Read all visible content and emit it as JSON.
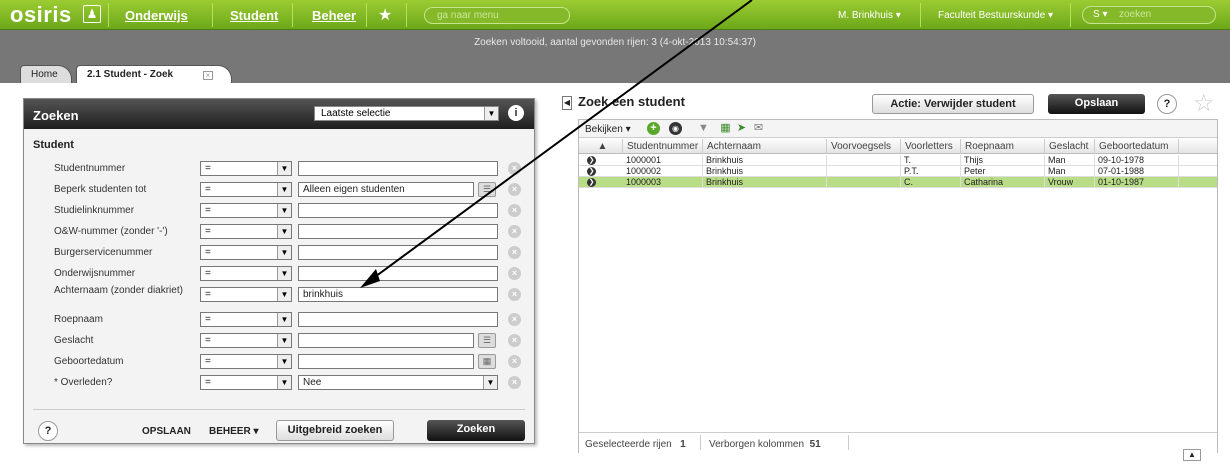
{
  "topbar": {
    "logo": "osiris",
    "logo_icon": "person-icon",
    "nav": [
      "Onderwijs",
      "Student",
      "Beheer"
    ],
    "favorites_icon": "star-icon",
    "menu_search_placeholder": "ga naar menu",
    "user": "M. Brinkhuis ▾",
    "faculty": "Faculteit Bestuurskunde ▾",
    "search_scope": "S ▾",
    "search_placeholder": "zoeken"
  },
  "status": "Zoeken voltooid, aantal gevonden rijen: 3 (4-okt-2013 10:54:37)",
  "tabs": [
    {
      "label": "Home"
    },
    {
      "label": "2.1 Student - Zoek"
    }
  ],
  "search_panel": {
    "title": "Zoeken",
    "saved_selection": "Laatste selectie",
    "section": "Student",
    "fields": [
      {
        "label": "Studentnummer",
        "op": "=",
        "value": ""
      },
      {
        "label": "Beperk studenten tot",
        "op": "=",
        "value": "Alleen eigen studenten"
      },
      {
        "label": "Studielinknummer",
        "op": "=",
        "value": ""
      },
      {
        "label": "O&W-nummer (zonder '-')",
        "op": "=",
        "value": ""
      },
      {
        "label": "Burgerservicenummer",
        "op": "=",
        "value": ""
      },
      {
        "label": "Onderwijsnummer",
        "op": "=",
        "value": ""
      },
      {
        "label": "Achternaam (zonder diakriet)",
        "op": "=",
        "value": "brinkhuis"
      },
      {
        "label": "Roepnaam",
        "op": "=",
        "value": ""
      },
      {
        "label": "Geslacht",
        "op": "=",
        "value": ""
      },
      {
        "label": "Geboortedatum",
        "op": "=",
        "value": ""
      },
      {
        "label": "* Overleden?",
        "op": "=",
        "value": "Nee"
      }
    ],
    "footer": {
      "help": "?",
      "save": "OPSLAAN",
      "manage": "BEHEER ▾",
      "advanced": "Uitgebreid zoeken",
      "search": "Zoeken"
    }
  },
  "results": {
    "title": "Zoek een student",
    "action_button": "Actie: Verwijder student",
    "save_button": "Opslaan",
    "help": "?",
    "toolbar": {
      "view": "Bekijken ▾"
    },
    "columns": [
      "",
      "Studentnummer",
      "Achternaam",
      "Voorvoegsels",
      "Voorletters",
      "Roepnaam",
      "Geslacht",
      "Geboortedatum"
    ],
    "rows": [
      [
        "1000001",
        "Brinkhuis",
        "",
        "T.",
        "Thijs",
        "Man",
        "09-10-1978"
      ],
      [
        "1000002",
        "Brinkhuis",
        "",
        "P.T.",
        "Peter",
        "Man",
        "07-01-1988"
      ],
      [
        "1000003",
        "Brinkhuis",
        "",
        "C.",
        "Catharina",
        "Vrouw",
        "01-10-1987"
      ]
    ],
    "selected_row_color": "#b9dc86",
    "footer": {
      "selected_label": "Geselecteerde rijen",
      "selected_count": "1",
      "hidden_label": "Verborgen kolommen",
      "hidden_count": "51"
    }
  },
  "colors": {
    "accent": "#7ab623",
    "header_dark": "#1e1e1e"
  }
}
